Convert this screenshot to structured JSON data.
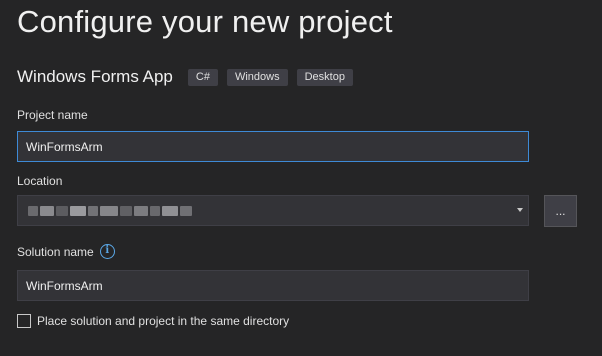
{
  "header": {
    "title": "Configure your new project"
  },
  "template": {
    "name": "Windows Forms App",
    "tags": [
      "C#",
      "Windows",
      "Desktop"
    ]
  },
  "project_name": {
    "label": "Project name",
    "value": "WinFormsArm"
  },
  "location": {
    "label": "Location",
    "browse_label": "..."
  },
  "solution_name": {
    "label": "Solution name",
    "info_icon_glyph": "i",
    "value": "WinFormsArm"
  },
  "same_directory": {
    "label": "Place solution and project in the same directory",
    "checked": false
  },
  "colors": {
    "background": "#252526",
    "input_background": "#333337",
    "focus_border": "#3e8ad6",
    "info_accent": "#5aa7e6"
  }
}
